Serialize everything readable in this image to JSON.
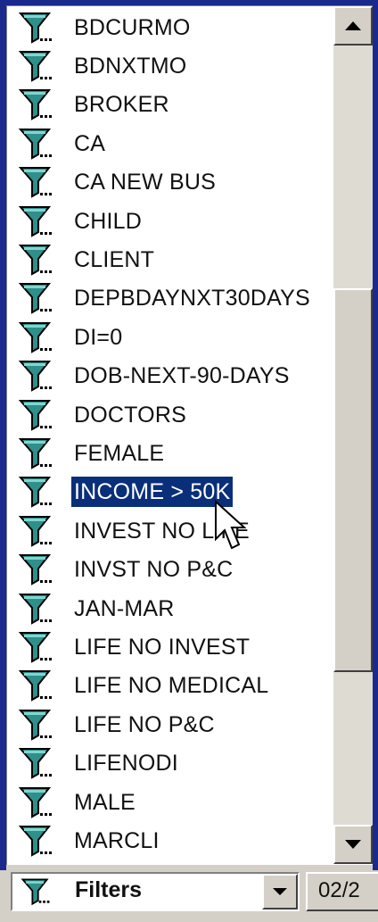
{
  "filters_list": {
    "items": [
      {
        "label": "BDCURMO",
        "icon": "filter-icon"
      },
      {
        "label": "BDNXTMO",
        "icon": "filter-icon"
      },
      {
        "label": "BROKER",
        "icon": "filter-icon"
      },
      {
        "label": "CA",
        "icon": "filter-icon"
      },
      {
        "label": "CA NEW BUS",
        "icon": "filter-icon"
      },
      {
        "label": "CHILD",
        "icon": "filter-icon"
      },
      {
        "label": "CLIENT",
        "icon": "filter-icon"
      },
      {
        "label": "DEPBDAYNXT30DAYS",
        "icon": "filter-icon"
      },
      {
        "label": "DI=0",
        "icon": "filter-icon"
      },
      {
        "label": "DOB-NEXT-90-DAYS",
        "icon": "filter-icon"
      },
      {
        "label": "DOCTORS",
        "icon": "filter-icon"
      },
      {
        "label": "FEMALE",
        "icon": "filter-icon"
      },
      {
        "label": "INCOME > 50K",
        "icon": "filter-icon",
        "selected": true
      },
      {
        "label": "INVEST NO LIFE",
        "icon": "filter-icon"
      },
      {
        "label": "INVST NO P&C",
        "icon": "filter-icon"
      },
      {
        "label": "JAN-MAR",
        "icon": "filter-icon"
      },
      {
        "label": "LIFE NO INVEST",
        "icon": "filter-icon"
      },
      {
        "label": "LIFE NO MEDICAL",
        "icon": "filter-icon"
      },
      {
        "label": "LIFE NO P&C",
        "icon": "filter-icon"
      },
      {
        "label": "LIFENODI",
        "icon": "filter-icon"
      },
      {
        "label": "MALE",
        "icon": "filter-icon"
      },
      {
        "label": "MARCLI",
        "icon": "filter-icon"
      }
    ],
    "scroll_position": 0.33
  },
  "combo": {
    "label": "Filters",
    "icon": "filter-icon"
  },
  "date_field": {
    "value": "02/2"
  },
  "colors": {
    "selection": "#0a2f7a",
    "frame": "#1a2a8c",
    "icon_funnel": "#2f8f8a"
  }
}
